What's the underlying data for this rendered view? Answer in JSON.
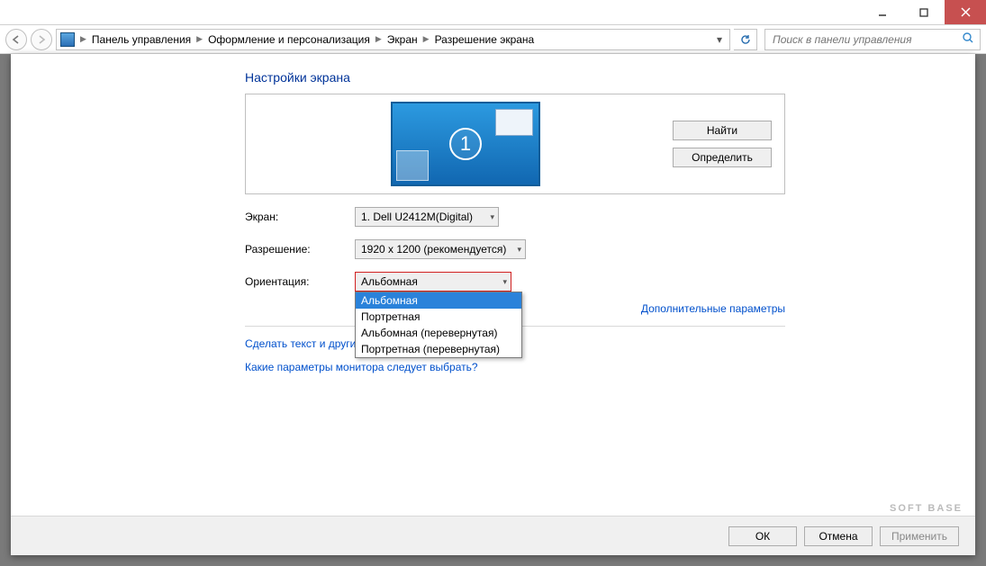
{
  "titlebar": {
    "min_icon": "minimize",
    "max_icon": "maximize",
    "close_icon": "close"
  },
  "breadcrumbs": {
    "items": [
      "Панель управления",
      "Оформление и персонализация",
      "Экран",
      "Разрешение экрана"
    ]
  },
  "search": {
    "placeholder": "Поиск в панели управления"
  },
  "heading": "Настройки экрана",
  "preview": {
    "find_label": "Найти",
    "identify_label": "Определить",
    "monitor_num": "1"
  },
  "form": {
    "display": {
      "label": "Экран:",
      "value": "1. Dell U2412M(Digital)"
    },
    "resolution": {
      "label": "Разрешение:",
      "value": "1920 x 1200 (рекомендуется)"
    },
    "orientation": {
      "label": "Ориентация:",
      "value": "Альбомная",
      "options": [
        "Альбомная",
        "Портретная",
        "Альбомная (перевернутая)",
        "Портретная (перевернутая)"
      ]
    }
  },
  "advanced_link": "Дополнительные параметры",
  "link1": "Сделать текст и другие",
  "link2": "Какие параметры монитора следует выбрать?",
  "buttons": {
    "ok": "ОК",
    "cancel": "Отмена",
    "apply": "Применить"
  },
  "watermark": "SOFT BASE"
}
